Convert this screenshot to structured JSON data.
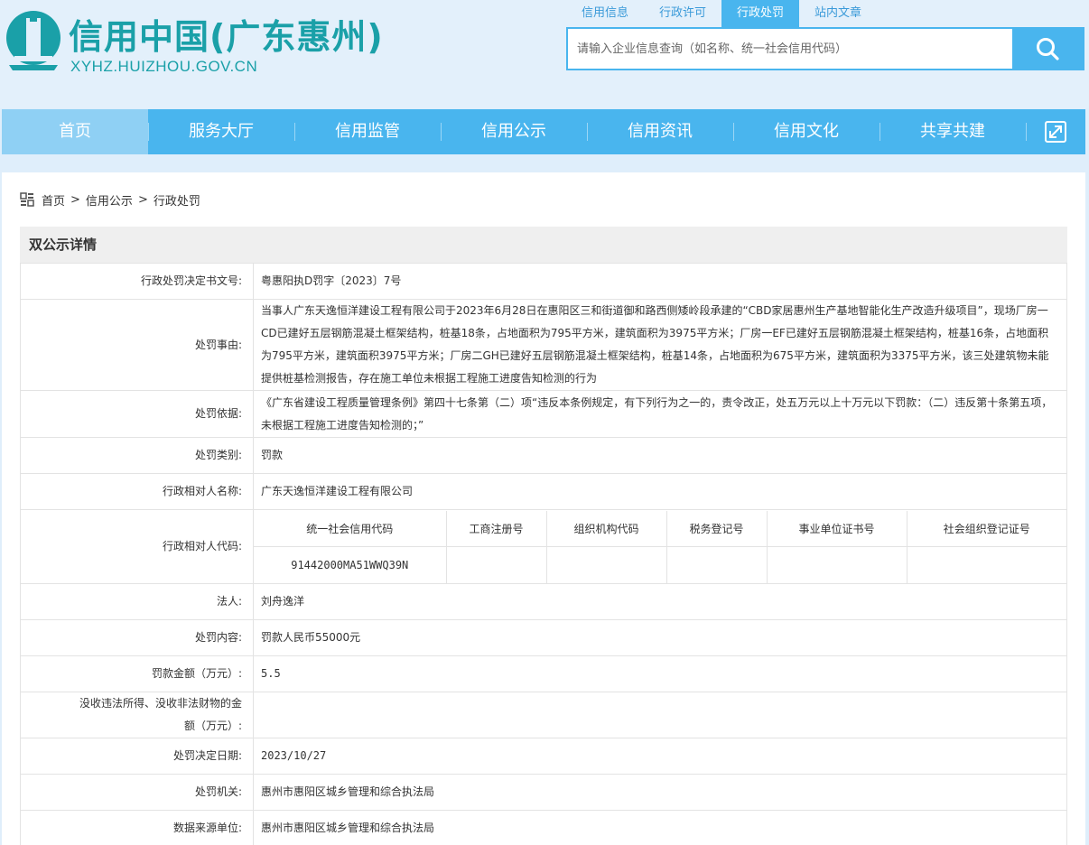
{
  "header": {
    "title": "信用中国(广东惠州)",
    "url": "XYHZ.HUIZHOU.GOV.CN",
    "colors": {
      "brand": "#1aa0a8",
      "accent": "#49b5ee"
    }
  },
  "search": {
    "tabs": [
      "信用信息",
      "行政许可",
      "行政处罚",
      "站内文章"
    ],
    "active_tab": "行政处罚",
    "placeholder": "请输入企业信息查询（如名称、统一社会信用代码）",
    "button_icon": "search-icon"
  },
  "nav": {
    "items": [
      "首页",
      "服务大厅",
      "信用监管",
      "信用公示",
      "信用资讯",
      "信用文化",
      "共享共建"
    ],
    "active": "首页",
    "expand_icon": "expand-icon"
  },
  "breadcrumb": {
    "icon": "grid-icon",
    "items": [
      "首页",
      "信用公示",
      "行政处罚"
    ],
    "separator": ">"
  },
  "detail": {
    "title": "双公示详情",
    "rows": [
      {
        "label": "行政处罚决定书文号:",
        "value": "粤惠阳执D罚字〔2023〕7号"
      },
      {
        "label": "处罚事由:",
        "value": "当事人广东天逸恒洋建设工程有限公司于2023年6月28日在惠阳区三和街道御和路西侧矮岭段承建的“CBD家居惠州生产基地智能化生产改造升级项目”，现场厂房一CD已建好五层钢筋混凝土框架结构，桩基18条，占地面积为795平方米，建筑面积为3975平方米；厂房一EF已建好五层钢筋混凝土框架结构，桩基16条，占地面积为795平方米，建筑面积3975平方米；厂房二GH已建好五层钢筋混凝土框架结构，桩基14条，占地面积为675平方米，建筑面积为3375平方米，该三处建筑物未能提供桩基检测报告，存在施工单位未根据工程施工进度告知检测的行为"
      },
      {
        "label": "处罚依据:",
        "value": "《广东省建设工程质量管理条例》第四十七条第（二）项“违反本条例规定，有下列行为之一的，责令改正，处五万元以上十万元以下罚款：（二）违反第十条第五项，未根据工程施工进度告知检测的；”"
      },
      {
        "label": "处罚类别:",
        "value": "罚款"
      },
      {
        "label": "行政相对人名称:",
        "value": "广东天逸恒洋建设工程有限公司"
      }
    ],
    "codes": {
      "label": "行政相对人代码:",
      "headers": [
        "统一社会信用代码",
        "工商注册号",
        "组织机构代码",
        "税务登记号",
        "事业单位证书号",
        "社会组织登记证号"
      ],
      "values": [
        "91442000MA51WWQ39N",
        "",
        "",
        "",
        "",
        ""
      ]
    },
    "rows2": [
      {
        "label": "法人:",
        "value": "刘舟逸洋"
      },
      {
        "label": "处罚内容:",
        "value": "罚款人民币55000元"
      },
      {
        "label": "罚款金额（万元）:",
        "value": "5.5"
      },
      {
        "label": "没收违法所得、没收非法财物的金额（万元）:",
        "value": ""
      },
      {
        "label": "处罚决定日期:",
        "value": "2023/10/27"
      },
      {
        "label": "处罚机关:",
        "value": "惠州市惠阳区城乡管理和综合执法局"
      },
      {
        "label": "数据来源单位:",
        "value": "惠州市惠阳区城乡管理和综合执法局"
      }
    ]
  }
}
